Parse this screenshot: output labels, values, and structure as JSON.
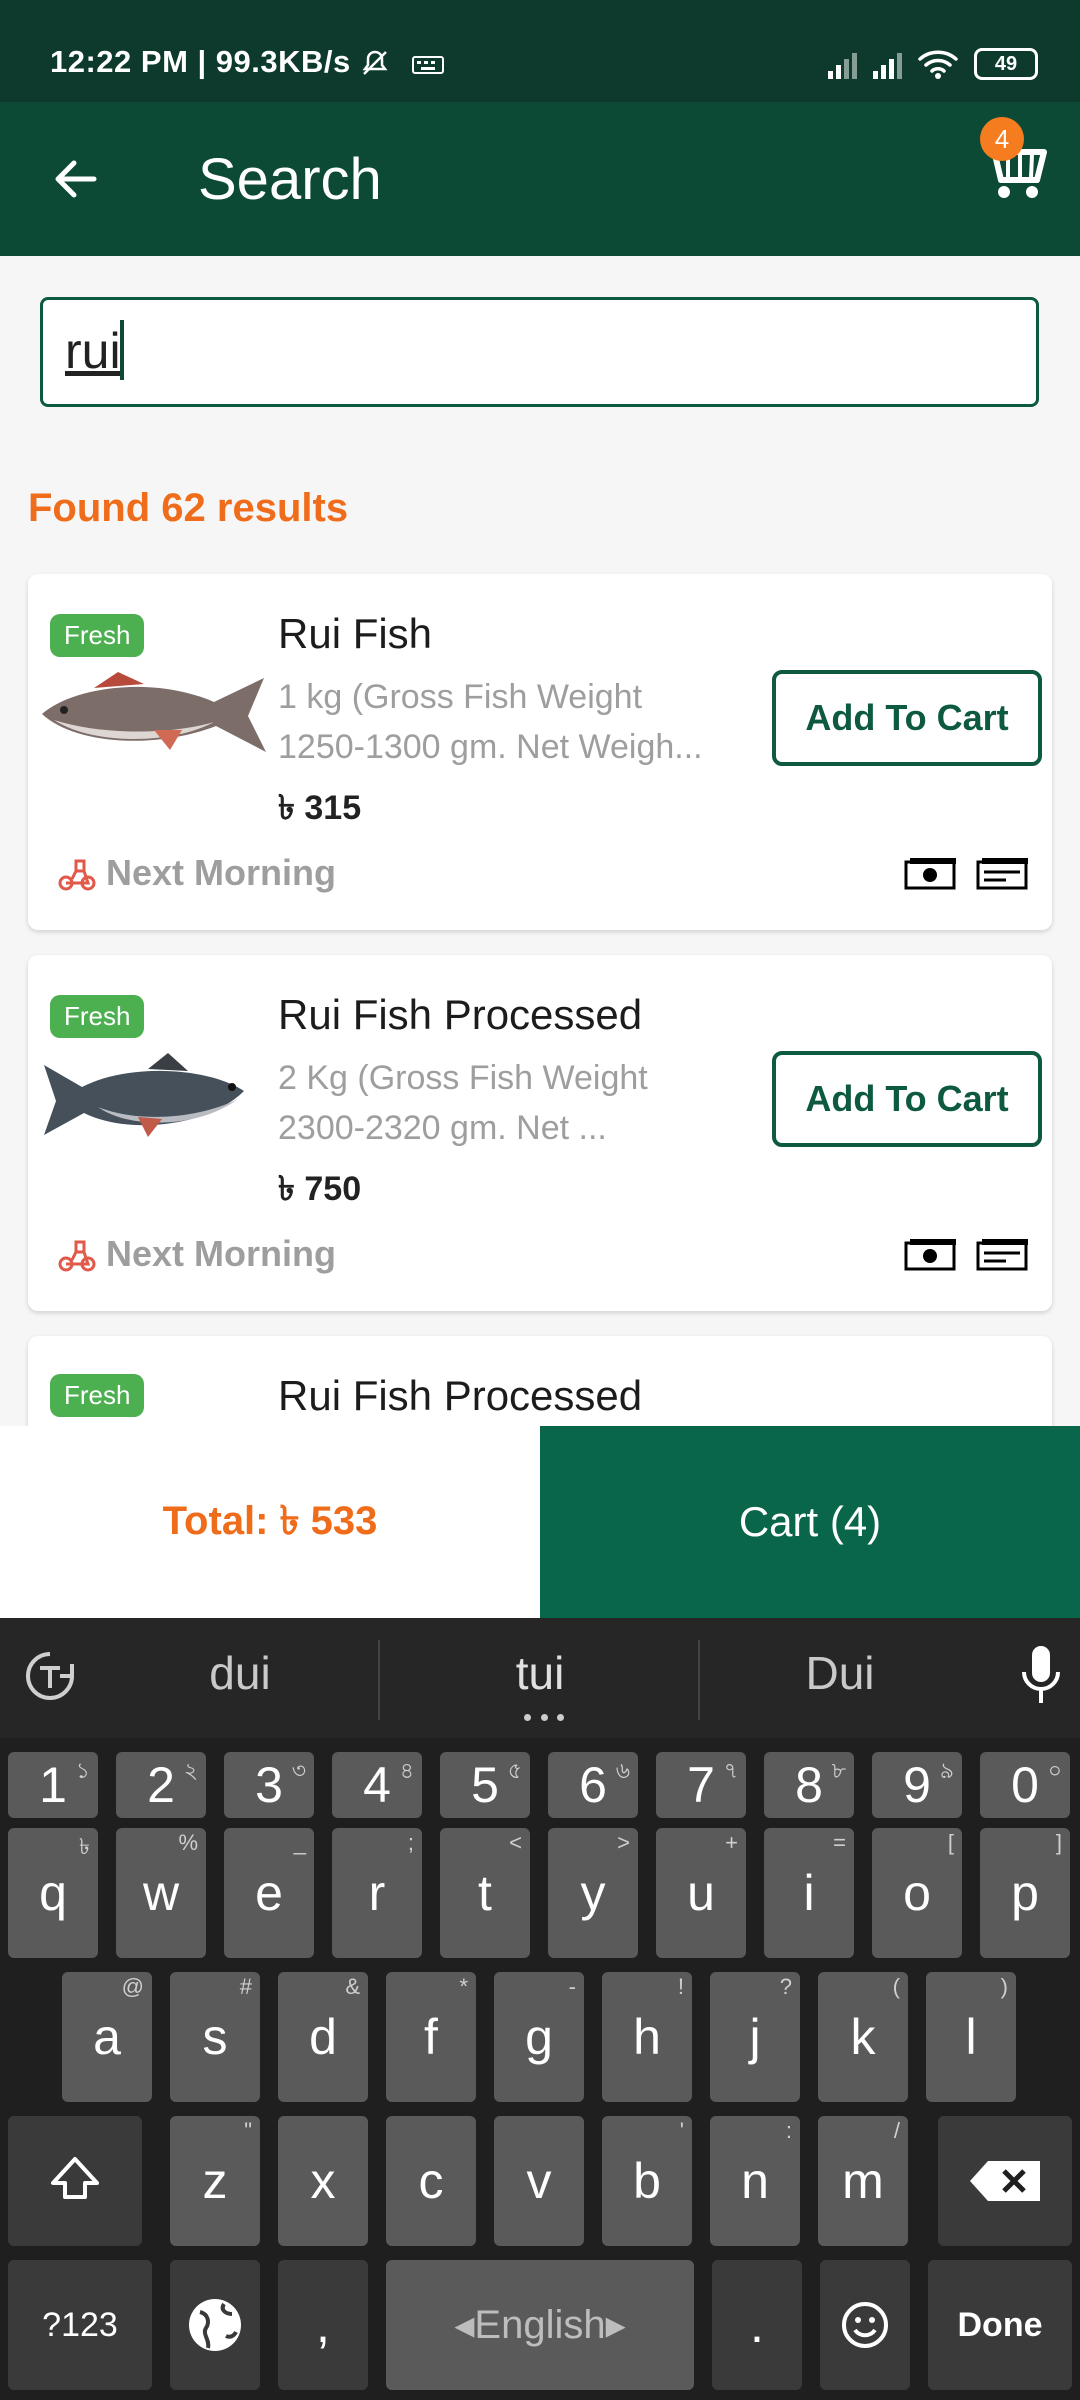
{
  "status_bar": {
    "time": "12:22 PM | 99.3KB/s",
    "battery": "49"
  },
  "app_bar": {
    "title": "Search",
    "cart_count": "4"
  },
  "search": {
    "value": "rui"
  },
  "results_text": "Found 62 results",
  "products": [
    {
      "badge": "Fresh",
      "name": "Rui Fish",
      "desc_line1": "1 kg (Gross Fish Weight",
      "desc_line2": "1250-1300 gm. Net Weigh...",
      "price": "৳ 315",
      "button": "Add To Cart",
      "delivery": "Next Morning"
    },
    {
      "badge": "Fresh",
      "name": "Rui Fish Processed",
      "desc_line1": "2 Kg (Gross Fish Weight",
      "desc_line2": "2300-2320 gm. Net ...",
      "price": "৳ 750",
      "button": "Add To Cart",
      "delivery": "Next Morning"
    },
    {
      "badge": "Fresh",
      "name": "Rui Fish Processed"
    }
  ],
  "bottom_bar": {
    "total": "Total: ৳ 533",
    "cart": "Cart (4)"
  },
  "keyboard": {
    "suggestions": [
      "dui",
      "tui",
      "Dui"
    ],
    "num_row": [
      {
        "k": "1",
        "s": "১"
      },
      {
        "k": "2",
        "s": "২"
      },
      {
        "k": "3",
        "s": "৩"
      },
      {
        "k": "4",
        "s": "৪"
      },
      {
        "k": "5",
        "s": "৫"
      },
      {
        "k": "6",
        "s": "৬"
      },
      {
        "k": "7",
        "s": "৭"
      },
      {
        "k": "8",
        "s": "৮"
      },
      {
        "k": "9",
        "s": "৯"
      },
      {
        "k": "0",
        "s": "০"
      }
    ],
    "row1": [
      {
        "k": "q",
        "s": "৳"
      },
      {
        "k": "w",
        "s": "%"
      },
      {
        "k": "e",
        "s": "_"
      },
      {
        "k": "r",
        "s": ";"
      },
      {
        "k": "t",
        "s": "<"
      },
      {
        "k": "y",
        "s": ">"
      },
      {
        "k": "u",
        "s": "+"
      },
      {
        "k": "i",
        "s": "="
      },
      {
        "k": "o",
        "s": "["
      },
      {
        "k": "p",
        "s": "]"
      }
    ],
    "row2": [
      {
        "k": "a",
        "s": "@"
      },
      {
        "k": "s",
        "s": "#"
      },
      {
        "k": "d",
        "s": "&"
      },
      {
        "k": "f",
        "s": "*"
      },
      {
        "k": "g",
        "s": "-"
      },
      {
        "k": "h",
        "s": "!"
      },
      {
        "k": "j",
        "s": "?"
      },
      {
        "k": "k",
        "s": "("
      },
      {
        "k": "l",
        "s": ")"
      }
    ],
    "row3": [
      {
        "k": "z",
        "s": "\""
      },
      {
        "k": "x",
        "s": ""
      },
      {
        "k": "c",
        "s": ""
      },
      {
        "k": "v",
        "s": ""
      },
      {
        "k": "b",
        "s": "'"
      },
      {
        "k": "n",
        "s": ":"
      },
      {
        "k": "m",
        "s": "/"
      }
    ],
    "symbols_key": "?123",
    "comma": ",",
    "space_label": "English",
    "period": ".",
    "done": "Done"
  },
  "colors": {
    "primary": "#0d4a35",
    "accent": "#ef6c1a",
    "fresh": "#4caf50"
  }
}
